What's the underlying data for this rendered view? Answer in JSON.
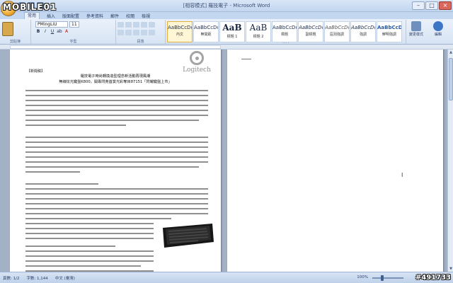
{
  "window": {
    "title": "[相容模式] 羅技電子 - Microsoft Word"
  },
  "watermark": {
    "site": "MOBILE01",
    "post_id": "#491733"
  },
  "ribbon": {
    "tabs": [
      "常用",
      "插入",
      "版面配置",
      "參考資料",
      "郵件",
      "校閱",
      "檢視"
    ],
    "font_name": "PMingLiU",
    "font_size": "11",
    "styles": [
      {
        "sample": "AaBbCcDc",
        "name": "內文"
      },
      {
        "sample": "AaBbCcDc",
        "name": "無間距"
      },
      {
        "sample": "AaB",
        "name": "標題 1"
      },
      {
        "sample": "AaB",
        "name": "標題 2"
      },
      {
        "sample": "AaBbCcDc",
        "name": "標題"
      },
      {
        "sample": "AaBbCcDc",
        "name": "副標題"
      },
      {
        "sample": "AaBbCcDc",
        "name": "區別強調"
      },
      {
        "sample": "AaBbCcDc",
        "name": "強調"
      },
      {
        "sample": "AaBbCcDc",
        "name": "鮮明強調"
      },
      {
        "sample": "AaBbCcDc",
        "name": "強調粗體"
      },
      {
        "sample": "AaBbCcDc",
        "name": "引文"
      }
    ],
    "change_styles_label": "變更樣式",
    "edit_label": "編輯",
    "groups": {
      "clipboard": "剪貼簿",
      "font": "字型",
      "paragraph": "段落",
      "styles": "樣式"
    }
  },
  "document": {
    "tag": "【新聞稿】",
    "title_line1": "羅技電子時尚轉換造型理念新活動再現風潮",
    "title_line2": "無線炫光鍵盤K800，開專閃亮首賞光彩奪目87151「閃耀鍵盤上市」",
    "logo_text": "Logitech"
  },
  "statusbar": {
    "page": "頁數: 1/2",
    "words": "字數: 1,144",
    "language": "中文 (臺灣)",
    "zoom": "100%"
  }
}
